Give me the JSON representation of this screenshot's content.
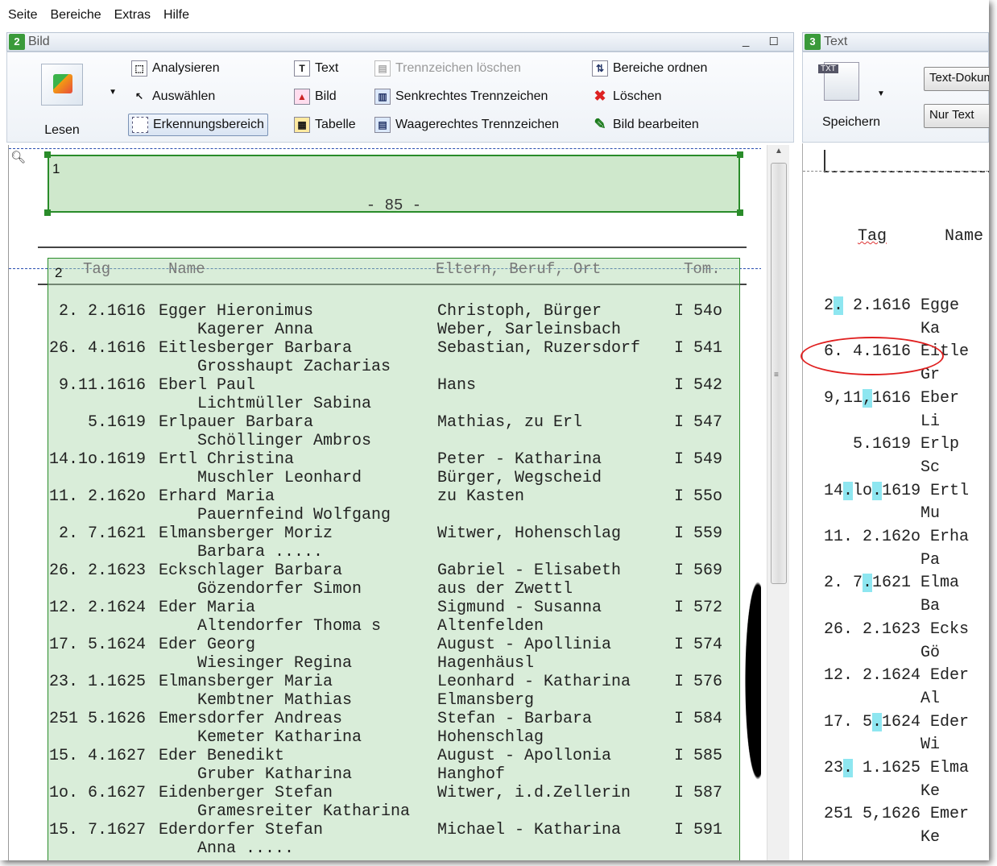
{
  "menu": [
    "Seite",
    "Bereiche",
    "Extras",
    "Hilfe"
  ],
  "left_pane": {
    "badge": "2",
    "title": "Bild",
    "window_buttons": "_ ◻",
    "read_button": "Lesen",
    "tools": {
      "analyze": "Analysieren",
      "select": "Auswählen",
      "recognition_area": "Erkennungsbereich",
      "text": "Text",
      "image": "Bild",
      "table": "Tabelle",
      "delete_separators": "Trennzeichen löschen",
      "vertical_separator": "Senkrechtes Trennzeichen",
      "horizontal_separator": "Waagerechtes Trennzeichen",
      "order_areas": "Bereiche ordnen",
      "delete": "Löschen",
      "edit_image": "Bild bearbeiten"
    },
    "zone1_number": "1",
    "page_number": "- 85 -",
    "zone2_number": "2",
    "headers": [
      "Tag",
      "Name",
      "Eltern, Beruf, Ort",
      "Tom."
    ],
    "rows": [
      {
        "date": " 2. 2.1616",
        "name": "Egger Hieronimus",
        "info": "Christoph, Bürger",
        "ref": "I 54o"
      },
      {
        "date": "",
        "name": "    Kagerer Anna",
        "info": "Weber, Sarleinsbach",
        "ref": ""
      },
      {
        "date": "26. 4.1616",
        "name": "Eitlesberger Barbara",
        "info": "Sebastian, Ruzersdorf",
        "ref": "I 541"
      },
      {
        "date": "",
        "name": "    Grosshaupt Zacharias",
        "info": "",
        "ref": ""
      },
      {
        "date": " 9.11.1616",
        "name": "Eberl Paul",
        "info": "Hans",
        "ref": "I 542"
      },
      {
        "date": "",
        "name": "    Lichtmüller Sabina",
        "info": "",
        "ref": ""
      },
      {
        "date": "    5.1619",
        "name": "Erlpauer Barbara",
        "info": "Mathias, zu Erl",
        "ref": "I 547"
      },
      {
        "date": "",
        "name": "    Schöllinger Ambros",
        "info": "",
        "ref": ""
      },
      {
        "date": "14.1o.1619",
        "name": "Ertl Christina",
        "info": "Peter - Katharina",
        "ref": "I 549"
      },
      {
        "date": "",
        "name": "    Muschler Leonhard",
        "info": "Bürger, Wegscheid",
        "ref": ""
      },
      {
        "date": "11. 2.162o",
        "name": "Erhard Maria",
        "info": "zu Kasten",
        "ref": "I 55o"
      },
      {
        "date": "",
        "name": "    Pauernfeind Wolfgang",
        "info": "",
        "ref": ""
      },
      {
        "date": " 2. 7.1621",
        "name": "Elmansberger Moriz",
        "info": "Witwer, Hohenschlag",
        "ref": "I 559"
      },
      {
        "date": "",
        "name": "    Barbara .....",
        "info": "",
        "ref": ""
      },
      {
        "date": "26. 2.1623",
        "name": "Eckschlager Barbara",
        "info": "Gabriel - Elisabeth",
        "ref": "I 569"
      },
      {
        "date": "",
        "name": "    Gözendorfer Simon",
        "info": "aus der Zwettl",
        "ref": ""
      },
      {
        "date": "12. 2.1624",
        "name": "Eder Maria",
        "info": "Sigmund - Susanna",
        "ref": "I 572"
      },
      {
        "date": "",
        "name": "    Altendorfer Thoma s",
        "info": "Altenfelden",
        "ref": ""
      },
      {
        "date": "17. 5.1624",
        "name": "Eder Georg",
        "info": "August - Apollinia",
        "ref": "I 574"
      },
      {
        "date": "",
        "name": "    Wiesinger Regina",
        "info": "Hagenhäusl",
        "ref": ""
      },
      {
        "date": "23. 1.1625",
        "name": "Elmansberger Maria",
        "info": "Leonhard - Katharina",
        "ref": "I 576"
      },
      {
        "date": "",
        "name": "    Kembtner Mathias",
        "info": "Elmansberg",
        "ref": ""
      },
      {
        "date": "251 5.1626",
        "name": "Emersdorfer Andreas",
        "info": "Stefan - Barbara",
        "ref": "I 584"
      },
      {
        "date": "",
        "name": "    Kemeter Katharina",
        "info": "Hohenschlag",
        "ref": ""
      },
      {
        "date": "15. 4.1627",
        "name": "Eder Benedikt",
        "info": "August - Apollonia",
        "ref": "I 585"
      },
      {
        "date": "",
        "name": "    Gruber Katharina",
        "info": "Hanghof",
        "ref": ""
      },
      {
        "date": "1o. 6.1627",
        "name": "Eidenberger Stefan",
        "info": "Witwer, i.d.Zellerin",
        "ref": "I 587"
      },
      {
        "date": "",
        "name": "    Gramesreiter Katharina",
        "info": "",
        "ref": ""
      },
      {
        "date": "15. 7.1627",
        "name": "Ederdorfer Stefan",
        "info": "Michael - Katharina",
        "ref": "I 591"
      },
      {
        "date": "",
        "name": "    Anna .....",
        "info": "",
        "ref": ""
      }
    ]
  },
  "right_pane": {
    "badge": "3",
    "title": "Text",
    "save_button": "Speichern",
    "save_icon_label": "TXT",
    "doc_select": "Text-Dokument",
    "mode_select": "Nur Text",
    "header_tag": "Tag",
    "header_name": "Name",
    "lines": [
      [
        "2",
        ".",
        " 2.1616 Egge"
      ],
      [
        "",
        "",
        "          Ka"
      ],
      [
        "6. 4.1616 ",
        "",
        "Eitle"
      ],
      [
        "",
        "",
        "          Gr"
      ],
      [
        "9,11",
        ",",
        "1616 Eber"
      ],
      [
        "",
        "",
        "          Li"
      ],
      [
        "   5.1619 ",
        "",
        "Erlp"
      ],
      [
        "",
        "",
        "          Sc"
      ],
      [
        "14",
        ".",
        "lo",
        ".",
        "1619 Ertl"
      ],
      [
        "",
        "",
        "          Mu"
      ],
      [
        "11. 2.162o ",
        "",
        "Erha"
      ],
      [
        "",
        "",
        "          Pa"
      ],
      [
        "2. 7",
        ".",
        "1621 Elma"
      ],
      [
        "",
        "",
        "          Ba"
      ],
      [
        "26. 2.1623 Ecks"
      ],
      [
        "",
        "",
        "          Gö"
      ],
      [
        "12. 2.1624 Eder"
      ],
      [
        "",
        "",
        "          Al"
      ],
      [
        "17. 5",
        ".",
        "1624 Eder"
      ],
      [
        "",
        "",
        "          Wi"
      ],
      [
        "23",
        ".",
        " 1.1625 Elma"
      ],
      [
        "",
        "",
        "          Ke"
      ],
      [
        "251 5,1626 Emer"
      ],
      [
        "",
        "",
        "          Ke"
      ]
    ]
  }
}
